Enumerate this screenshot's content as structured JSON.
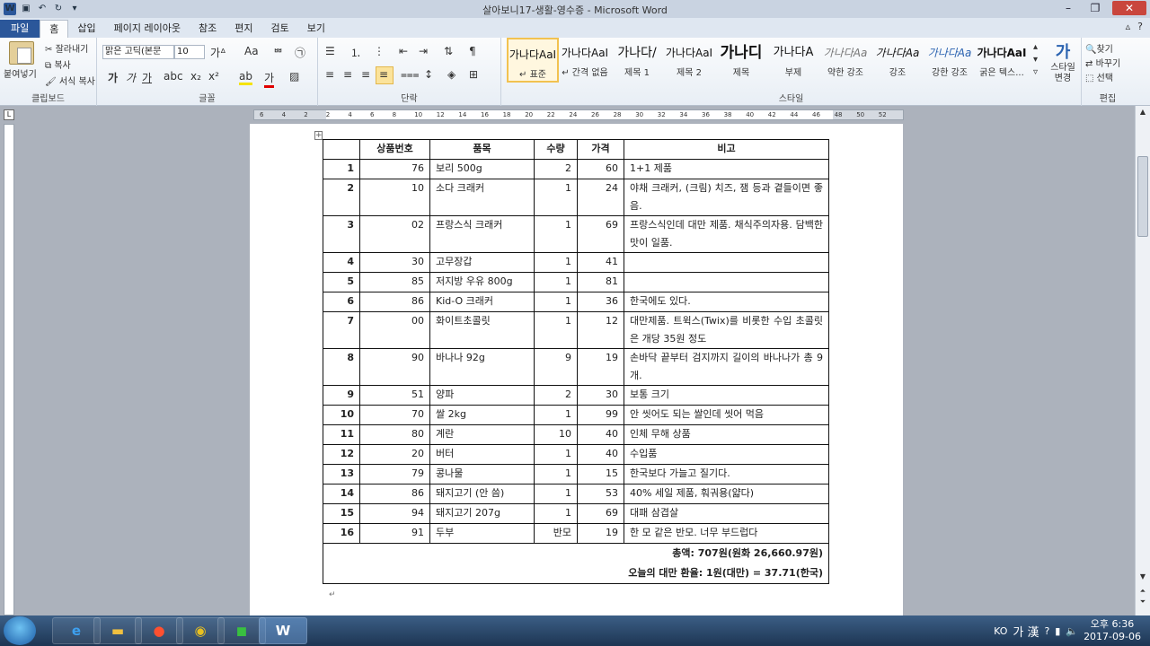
{
  "window": {
    "title": "살아보니17-생활-영수증 - Microsoft Word",
    "logo": "W"
  },
  "tabs": [
    {
      "label": "파일"
    },
    {
      "label": "홈"
    },
    {
      "label": "삽입"
    },
    {
      "label": "페이지 레이아웃"
    },
    {
      "label": "참조"
    },
    {
      "label": "편지"
    },
    {
      "label": "검토"
    },
    {
      "label": "보기"
    }
  ],
  "ribbon": {
    "clipboard": {
      "paste": "붙여넣기",
      "cut": "잘라내기",
      "copy": "복사",
      "format_painter": "서식 복사",
      "group": "클립보드"
    },
    "font": {
      "name": "맑은 고딕(본문",
      "size": "10",
      "group": "글꼴",
      "bold": "가",
      "italic": "가",
      "underline": "가"
    },
    "paragraph": {
      "group": "단락"
    },
    "styles": {
      "group": "스타일",
      "items": [
        {
          "sample": "가나다AaI",
          "name": "↵ 표준"
        },
        {
          "sample": "가나다AaI",
          "name": "↵ 간격 없음"
        },
        {
          "sample": "가나다/",
          "name": "제목 1"
        },
        {
          "sample": "가나다AaI",
          "name": "제목 2"
        },
        {
          "sample": "가나디",
          "name": "제목"
        },
        {
          "sample": "가나다A",
          "name": "부제"
        },
        {
          "sample": "가나다Aa",
          "name": "약한 강조"
        },
        {
          "sample": "가나다Aa",
          "name": "강조"
        },
        {
          "sample": "가나다Aa",
          "name": "강한 강조"
        },
        {
          "sample": "가나다AaI",
          "name": "굵은 텍스..."
        }
      ],
      "change": "스타일 변경"
    },
    "editing": {
      "group": "편집",
      "find": "찾기",
      "replace": "바꾸기",
      "select": "선택"
    }
  },
  "ruler": {
    "marks": [
      "6",
      "4",
      "2",
      "2",
      "4",
      "6",
      "8",
      "10",
      "12",
      "14",
      "16",
      "18",
      "20",
      "22",
      "24",
      "26",
      "28",
      "30",
      "32",
      "34",
      "36",
      "38",
      "40",
      "42",
      "44",
      "46",
      "48",
      "50",
      "52"
    ]
  },
  "table": {
    "headers": [
      "",
      "상품번호",
      "품목",
      "수량",
      "가격",
      "비고"
    ],
    "rows": [
      {
        "num": "1",
        "code": "76",
        "item": "보리 500g",
        "qty": "2",
        "price": "60",
        "note": "1+1 제품"
      },
      {
        "num": "2",
        "code": "10",
        "item": "소다 크래커",
        "qty": "1",
        "price": "24",
        "note": "야채 크래커, (크림) 치즈, 잼 등과 곁들이면 좋음."
      },
      {
        "num": "3",
        "code": "02",
        "item": "프랑스식 크래커",
        "qty": "1",
        "price": "69",
        "note": "프랑스식인데 대만 제품. 채식주의자용. 담백한 맛이 일품."
      },
      {
        "num": "4",
        "code": "30",
        "item": "고무장갑",
        "qty": "1",
        "price": "41",
        "note": ""
      },
      {
        "num": "5",
        "code": "85",
        "item": "저지방 우유 800g",
        "qty": "1",
        "price": "81",
        "note": ""
      },
      {
        "num": "6",
        "code": "86",
        "item": "Kid-O 크래커",
        "qty": "1",
        "price": "36",
        "note": "한국에도 있다."
      },
      {
        "num": "7",
        "code": "00",
        "item": "화이트초콜릿",
        "qty": "1",
        "price": "12",
        "note": "대만제품. 트윅스(Twix)를 비롯한 수입 초콜릿은 개당 35원 정도"
      },
      {
        "num": "8",
        "code": "90",
        "item": "바나나 92g",
        "qty": "9",
        "price": "19",
        "note": "손바닥 끝부터 검지까지 길이의 바나나가 총 9개."
      },
      {
        "num": "9",
        "code": "51",
        "item": "양파",
        "qty": "2",
        "price": "30",
        "note": "보통 크기"
      },
      {
        "num": "10",
        "code": "70",
        "item": "쌀 2kg",
        "qty": "1",
        "price": "99",
        "note": "안 씻어도 되는 쌀인데 씻어 먹음"
      },
      {
        "num": "11",
        "code": "80",
        "item": "계란",
        "qty": "10",
        "price": "40",
        "note": "인체 무해 상품"
      },
      {
        "num": "12",
        "code": "20",
        "item": "버터",
        "qty": "1",
        "price": "40",
        "note": "수입품"
      },
      {
        "num": "13",
        "code": "79",
        "item": "콩나물",
        "qty": "1",
        "price": "15",
        "note": "한국보다 가늘고 질기다."
      },
      {
        "num": "14",
        "code": "86",
        "item": "돼지고기 (안 씀)",
        "qty": "1",
        "price": "53",
        "note": "40% 세일 제품, 훠궈용(얇다)"
      },
      {
        "num": "15",
        "code": "94",
        "item": "돼지고기 207g",
        "qty": "1",
        "price": "69",
        "note": "대패 삼겹살"
      },
      {
        "num": "16",
        "code": "91",
        "item": "두부",
        "qty": "반모",
        "price": "19",
        "note": "한 모 같은 반모. 너무 부드럽다"
      }
    ],
    "total": "총액: 707원(원화 26,660.97원)",
    "exchange": "오늘의 대만 환율: 1원(대만) = 37.71(한국)"
  },
  "taskbar": {
    "lang": "KO",
    "ime": "가 漢",
    "time": "오후 6:36",
    "date": "2017-09-06"
  }
}
